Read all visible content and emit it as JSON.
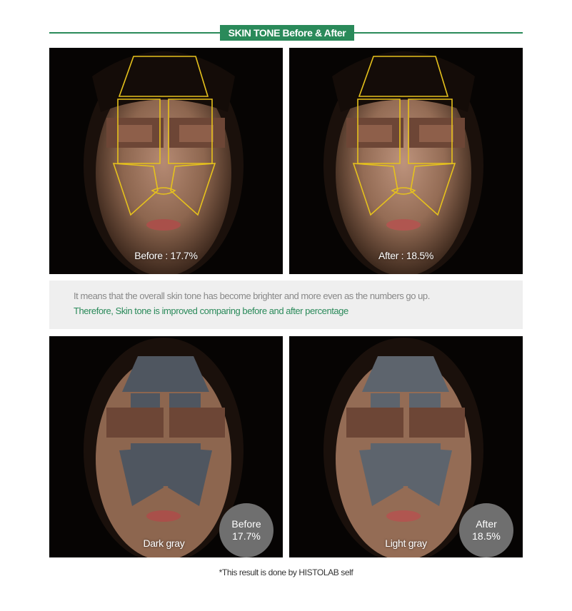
{
  "header": {
    "title": "SKIN TONE Before & After"
  },
  "panels": {
    "before_outline": {
      "caption": "Before : 17.7%"
    },
    "after_outline": {
      "caption": "After : 18.5%"
    },
    "before_gray": {
      "caption": "Dark gray",
      "badge_line1": "Before",
      "badge_line2": "17.7%"
    },
    "after_gray": {
      "caption": "Light gray",
      "badge_line1": "After",
      "badge_line2": "18.5%"
    }
  },
  "note": {
    "line1": "It means that the overall skin tone has become brighter and more even as the numbers go up.",
    "line2": "Therefore, Skin tone is improved comparing before and after percentage"
  },
  "footnote": "*This result is done by HISTOLAB self",
  "colors": {
    "accent_green": "#2a8a5a",
    "outline_yellow": "#e6c21c",
    "dark_gray_overlay": "#4f5660",
    "light_gray_overlay": "#5d646d"
  }
}
